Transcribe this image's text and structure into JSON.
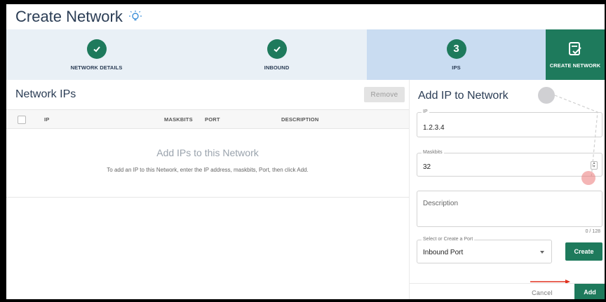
{
  "page": {
    "title": "Create Network",
    "title_icon": "lightbulb-icon"
  },
  "stepper": {
    "steps": [
      {
        "label": "NETWORK DETAILS",
        "state": "complete",
        "icon": "check-icon"
      },
      {
        "label": "INBOUND",
        "state": "complete",
        "icon": "check-icon"
      },
      {
        "label": "IPS",
        "state": "current",
        "number": "3"
      },
      {
        "label": "CREATE NETWORK",
        "state": "action",
        "icon": "create-network-icon"
      }
    ]
  },
  "network_ips": {
    "title": "Network IPs",
    "remove_label": "Remove",
    "columns": [
      "IP",
      "MASKBITS",
      "PORT",
      "DESCRIPTION"
    ],
    "empty_title": "Add IPs to this Network",
    "empty_subtitle": "To add an IP to this Network, enter the IP address, maskbits, Port, then click Add."
  },
  "add_ip": {
    "title": "Add IP to Network",
    "ip": {
      "label": "IP",
      "value": "1.2.3.4"
    },
    "maskbits": {
      "label": "Maskbits",
      "value": "32"
    },
    "description": {
      "placeholder": "Description",
      "counter": "0 / 128"
    },
    "port": {
      "label": "Select or Create a Port",
      "value": "Inbound Port"
    },
    "create_label": "Create",
    "cancel_label": "Cancel",
    "add_label": "Add"
  },
  "colors": {
    "primary": "#1e7a5c",
    "step_bg": "#e9f0f6",
    "step_current_bg": "#c9dcf1",
    "title": "#2b3d55",
    "annotation_arrow": "#e0301e"
  }
}
